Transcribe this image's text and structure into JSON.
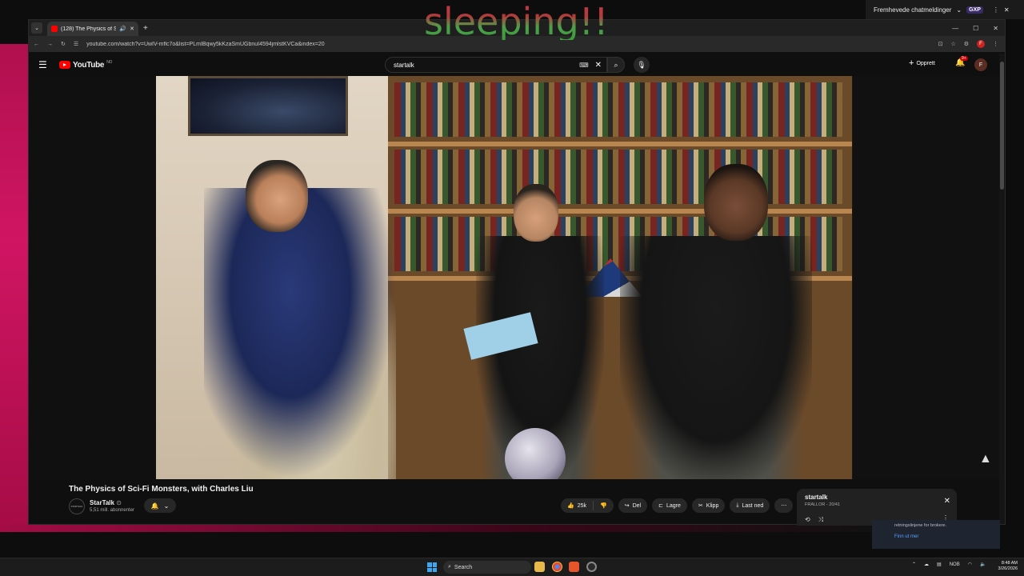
{
  "overlay": {
    "sleep_text": "sleeping!!"
  },
  "chat_app": {
    "label": "Fremhevede chatmeldinger",
    "badge": "GXP"
  },
  "browser": {
    "tab_title": "(128) The Physics of Sci-Fi M",
    "url": "youtube.com/watch?v=UwIV-mflc7o&list=PLmIBqwy5kKzaSmUGbnuI4594jmlstKVCa&index=20"
  },
  "youtube": {
    "logo_text": "YouTube",
    "logo_country": "NO",
    "search_value": "startalk",
    "create_label": "Opprett",
    "notification_count": "9+",
    "user_initial": "F"
  },
  "video": {
    "title": "The Physics of Sci-Fi Monsters, with Charles Liu",
    "channel": "StarTalk",
    "channel_logo_text": "STARTALK",
    "subscribers": "5,51 mill. abonnenter",
    "likes": "25k",
    "share_label": "Del",
    "save_label": "Lagre",
    "clip_label": "Klipp",
    "download_label": "Last ned"
  },
  "mix_panel": {
    "title": "startalk",
    "subtitle": "FRALLOR - 20/41"
  },
  "notification": {
    "text": "retningslinjene for brokere.",
    "link": "Finn ut mer"
  },
  "taskbar": {
    "search_label": "Search",
    "lang": "NOB",
    "time": "8:48 AM",
    "date": "3/26/2026"
  },
  "colors": {
    "accent": "#ff0000",
    "sleep_red": "#b83a3a",
    "sleep_green": "#3f9e3f"
  }
}
